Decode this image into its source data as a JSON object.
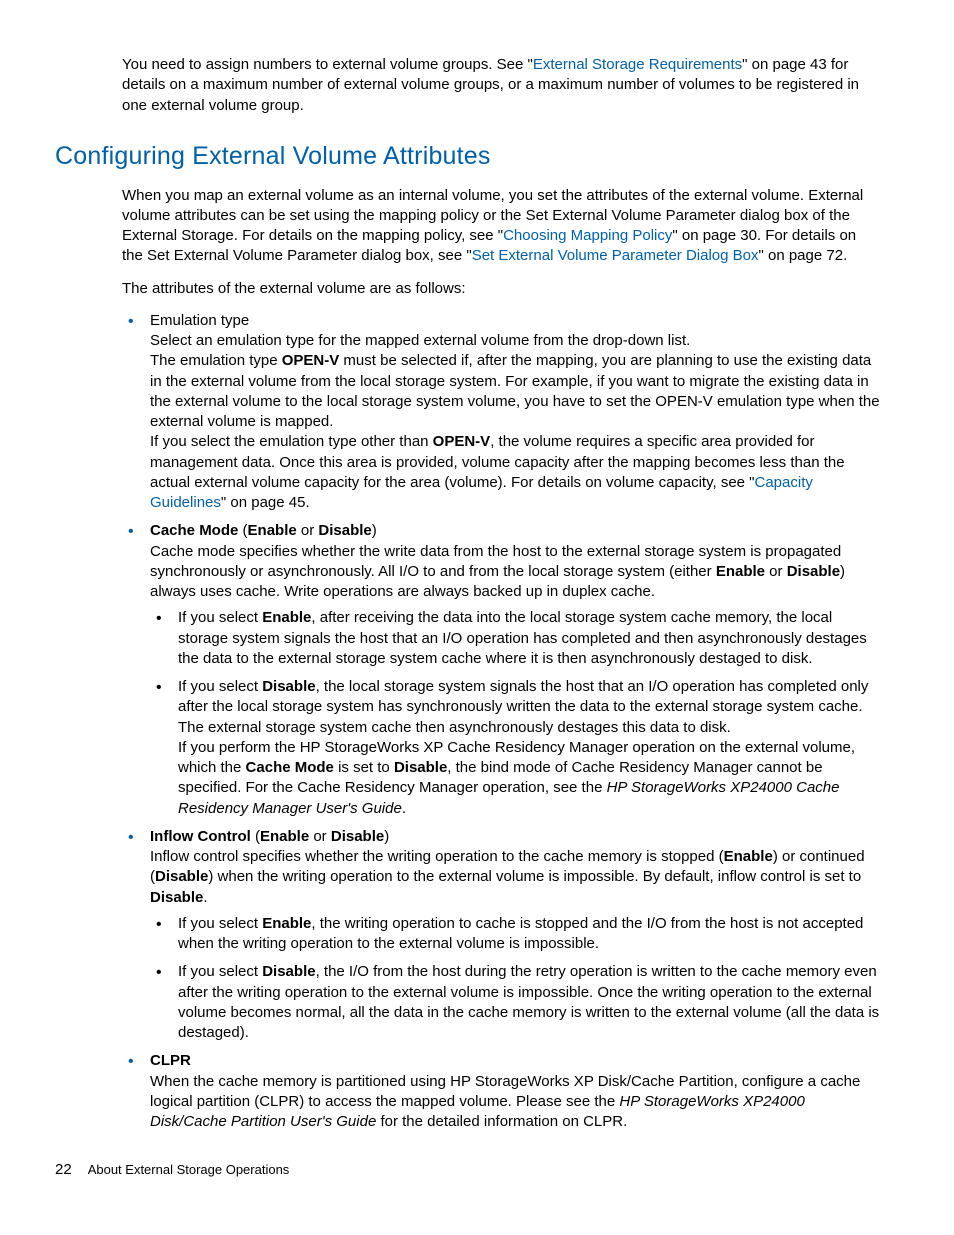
{
  "intro": {
    "t1": "You need to assign numbers to external volume groups. See \"",
    "link1": "External Storage Requirements",
    "t2": "\" on page 43 for details on a maximum number of external volume groups, or a maximum number of volumes to be registered in one external volume group."
  },
  "heading": "Configuring External Volume Attributes",
  "para1": {
    "t1": "When you map an external volume as an internal volume, you set the attributes of the external volume. External volume attributes can be set using the mapping policy or the Set External Volume Parameter dialog box of the External Storage. For details on the mapping policy, see \"",
    "link1": "Choosing Mapping Policy",
    "t2": "\" on page 30. For details on the Set External Volume Parameter dialog box, see \"",
    "link2": "Set External Volume Parameter Dialog Box",
    "t3": "\" on page 72."
  },
  "para2": "The attributes of the external volume are as follows:",
  "bullets": {
    "emu": {
      "title": "Emulation type",
      "p1a": "Select an emulation type for the mapped external volume from the drop-down list.",
      "p1b_pre": "The emulation type ",
      "p1b_bold": "OPEN-V",
      "p1b_post": " must be selected if, after the mapping, you are planning to use the existing data in the external volume from the local storage system. For example, if you want to migrate the existing data in the external volume to the local storage system volume, you have to set the OPEN-V emulation type when the external volume is mapped.",
      "p2_pre": "If you select the emulation type other than ",
      "p2_bold": "OPEN-V",
      "p2_post": ", the volume requires a specific area provided for management data. Once this area is provided, volume capacity after the mapping becomes less than the actual external volume capacity for the area (volume). For details on volume capacity, see \"",
      "p2_link": "Capacity Guidelines",
      "p2_end": "\" on page 45."
    },
    "cache": {
      "title_b1": "Cache Mode",
      "title_mid": " (",
      "title_b2": "Enable",
      "title_or": " or ",
      "title_b3": "Disable",
      "title_close": ")",
      "p1_pre": "Cache mode specifies whether the write data from the host to the external storage system is propagated synchronously or asynchronously. All I/O to and from the local storage system (either ",
      "p1_b1": "Enable",
      "p1_mid": " or ",
      "p1_b2": "Disable",
      "p1_post": ") always uses cache. Write operations are always backed up in duplex cache.",
      "sub_enable_pre": "If you select ",
      "sub_enable_b": "Enable",
      "sub_enable_post": ", after receiving the data into the local storage system cache memory, the local storage system signals the host that an I/O operation has completed and then asynchronously destages the data to the external storage system cache where it is then asynchronously destaged to disk.",
      "sub_disable_pre": "If you select ",
      "sub_disable_b": "Disable",
      "sub_disable_post": ", the local storage system signals the host that an I/O operation has completed only after the local storage system has synchronously written the data to the external storage system cache. The external storage system cache then asynchronously destages this data to disk.",
      "sub_disable2_pre": "If you perform the HP StorageWorks XP Cache Residency Manager operation on the external volume, which the ",
      "sub_disable2_b1": "Cache Mode",
      "sub_disable2_mid": " is set to ",
      "sub_disable2_b2": "Disable",
      "sub_disable2_post": ", the bind mode of Cache Residency Manager cannot be specified. For the Cache Residency Manager operation, see the ",
      "sub_disable2_i": "HP StorageWorks XP24000 Cache Residency Manager User's Guide",
      "sub_disable2_end": "."
    },
    "inflow": {
      "title_b1": "Inflow Control",
      "title_mid": " (",
      "title_b2": "Enable",
      "title_or": " or ",
      "title_b3": "Disable",
      "title_close": ")",
      "p1_pre": "Inflow control specifies whether the writing operation to the cache memory is stopped (",
      "p1_b1": "Enable",
      "p1_mid": ") or continued (",
      "p1_b2": "Disable",
      "p1_post": ") when the writing operation to the external volume is impossible. By default, inflow control is set to ",
      "p1_b3": "Disable",
      "p1_end": ".",
      "sub_enable_pre": "If you select ",
      "sub_enable_b": "Enable",
      "sub_enable_post": ", the writing operation to cache is stopped and the I/O from the host is not accepted when the writing operation to the external volume is impossible.",
      "sub_disable_pre": "If you select ",
      "sub_disable_b": "Disable",
      "sub_disable_post": ", the I/O from the host during the retry operation is written to the cache memory even after the writing operation to the external volume is impossible. Once the writing operation to the external volume becomes normal, all the data in the cache memory is written to the external volume (all the data is destaged)."
    },
    "clpr": {
      "title": "CLPR",
      "p1_pre": "When the cache memory is partitioned using HP StorageWorks XP Disk/Cache Partition, configure a cache logical partition (CLPR) to access the mapped volume. Please see the ",
      "p1_i": "HP StorageWorks XP24000 Disk/Cache Partition User's Guide",
      "p1_post": " for the detailed information on CLPR."
    }
  },
  "footer": {
    "page": "22",
    "title": "About External Storage Operations"
  }
}
